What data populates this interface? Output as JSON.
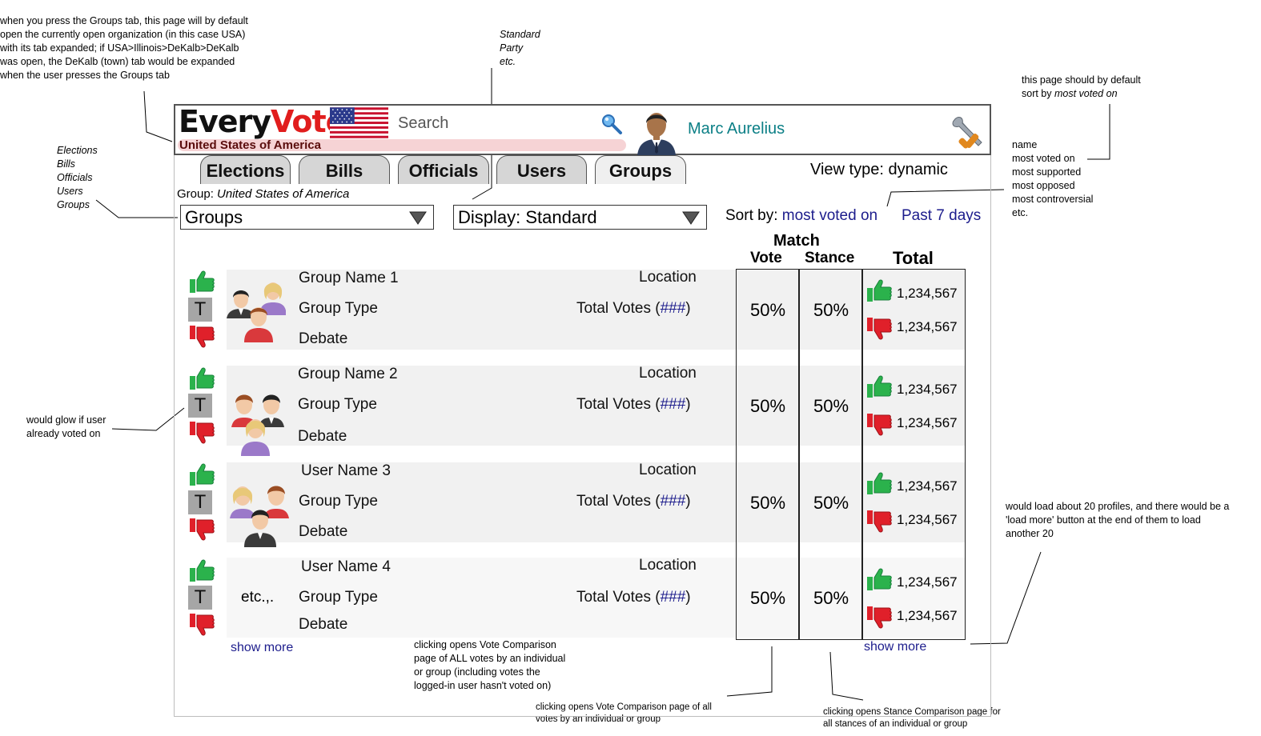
{
  "annotations": {
    "groups_tab_note": [
      "when you press the Groups tab, this page will by default",
      "open the currently open organization (in this case USA)",
      "with its tab expanded; if USA>Illinois>DeKalb>DeKalb",
      "was open, the DeKalb (town) tab would be expanded",
      "when the user presses the Groups tab"
    ],
    "display_options_note": [
      "Standard",
      "Party",
      "etc."
    ],
    "sort_default_note_prefix": "this page should by default",
    "sort_default_note_line2": "sort by ",
    "sort_default_note_emph": "most voted on",
    "nav_options_note": [
      "Elections",
      "Bills",
      "Officials",
      "Users",
      "Groups"
    ],
    "sort_options_note": [
      "name",
      "most voted on",
      "most supported",
      "most opposed",
      "most controversial",
      "etc."
    ],
    "glow_note": [
      "would glow if user",
      "already voted on"
    ],
    "load_more_note": [
      "would load about 20 profiles, and there would be a",
      "'load more' button at the end of them to load",
      "another 20"
    ],
    "vote_comparison_all_note": [
      "clicking opens Vote Comparison",
      "page of ALL votes by an individual",
      "or group (including votes the",
      "logged-in user hasn't voted on)"
    ],
    "vote_comparison_note": [
      "clicking opens Vote Comparison page of all",
      "votes by an individual or group"
    ],
    "stance_comparison_note": [
      "clicking opens Stance Comparison page for",
      "all stances of an individual or group"
    ]
  },
  "header": {
    "logo_every": "Every",
    "logo_vote": "Vote",
    "organization": "United States of America",
    "search_placeholder": "Search",
    "user_name": "Marc Aurelius"
  },
  "tabs": [
    {
      "label": "Elections"
    },
    {
      "label": "Bills"
    },
    {
      "label": "Officials"
    },
    {
      "label": "Users"
    },
    {
      "label": "Groups"
    }
  ],
  "view_type": "View type: dynamic",
  "group_prefix": "Group: ",
  "group_value": "United States of America",
  "filter_select": "Groups",
  "display_select": "Display: Standard",
  "sort_by_label": "Sort by: ",
  "sort_by_value": "most voted on",
  "time_range": "Past 7 days",
  "columns": {
    "match": "Match",
    "vote": "Vote",
    "stance": "Stance",
    "total": "Total"
  },
  "rows": [
    {
      "name": "Group Name 1",
      "type": "Group Type",
      "sub": "Debate",
      "location": "Location",
      "total_votes_prefix": "Total Votes (",
      "total_votes_hash": "###",
      "total_votes_suffix": ")",
      "vote_match": "50%",
      "stance_match": "50%",
      "up": "1,234,567",
      "down": "1,234,567"
    },
    {
      "name": "Group Name 2",
      "type": "Group Type",
      "sub": "Debate",
      "location": "Location",
      "total_votes_prefix": "Total Votes (",
      "total_votes_hash": "###",
      "total_votes_suffix": ")",
      "vote_match": "50%",
      "stance_match": "50%",
      "up": "1,234,567",
      "down": "1,234,567"
    },
    {
      "name": "User Name 3",
      "type": "Group Type",
      "sub": "Debate",
      "location": "Location",
      "total_votes_prefix": "Total Votes (",
      "total_votes_hash": "###",
      "total_votes_suffix": ")",
      "vote_match": "50%",
      "stance_match": "50%",
      "up": "1,234,567",
      "down": "1,234,567"
    },
    {
      "name": "User Name 4",
      "type": "Group Type",
      "sub": "Debate",
      "location": "Location",
      "total_votes_prefix": "Total Votes (",
      "total_votes_hash": "###",
      "total_votes_suffix": ")",
      "vote_match": "50%",
      "stance_match": "50%",
      "up": "1,234,567",
      "down": "1,234,567",
      "image_text": "etc.,."
    }
  ],
  "tbox_label": "T",
  "show_more_left": "show more",
  "show_more_right": "show more",
  "colors": {
    "brand_red": "#e11d1d",
    "link_blue": "#1c1c8c",
    "user_teal": "#0b7f86",
    "thumb_up": "#2bb24c",
    "thumb_down": "#e0202a"
  }
}
